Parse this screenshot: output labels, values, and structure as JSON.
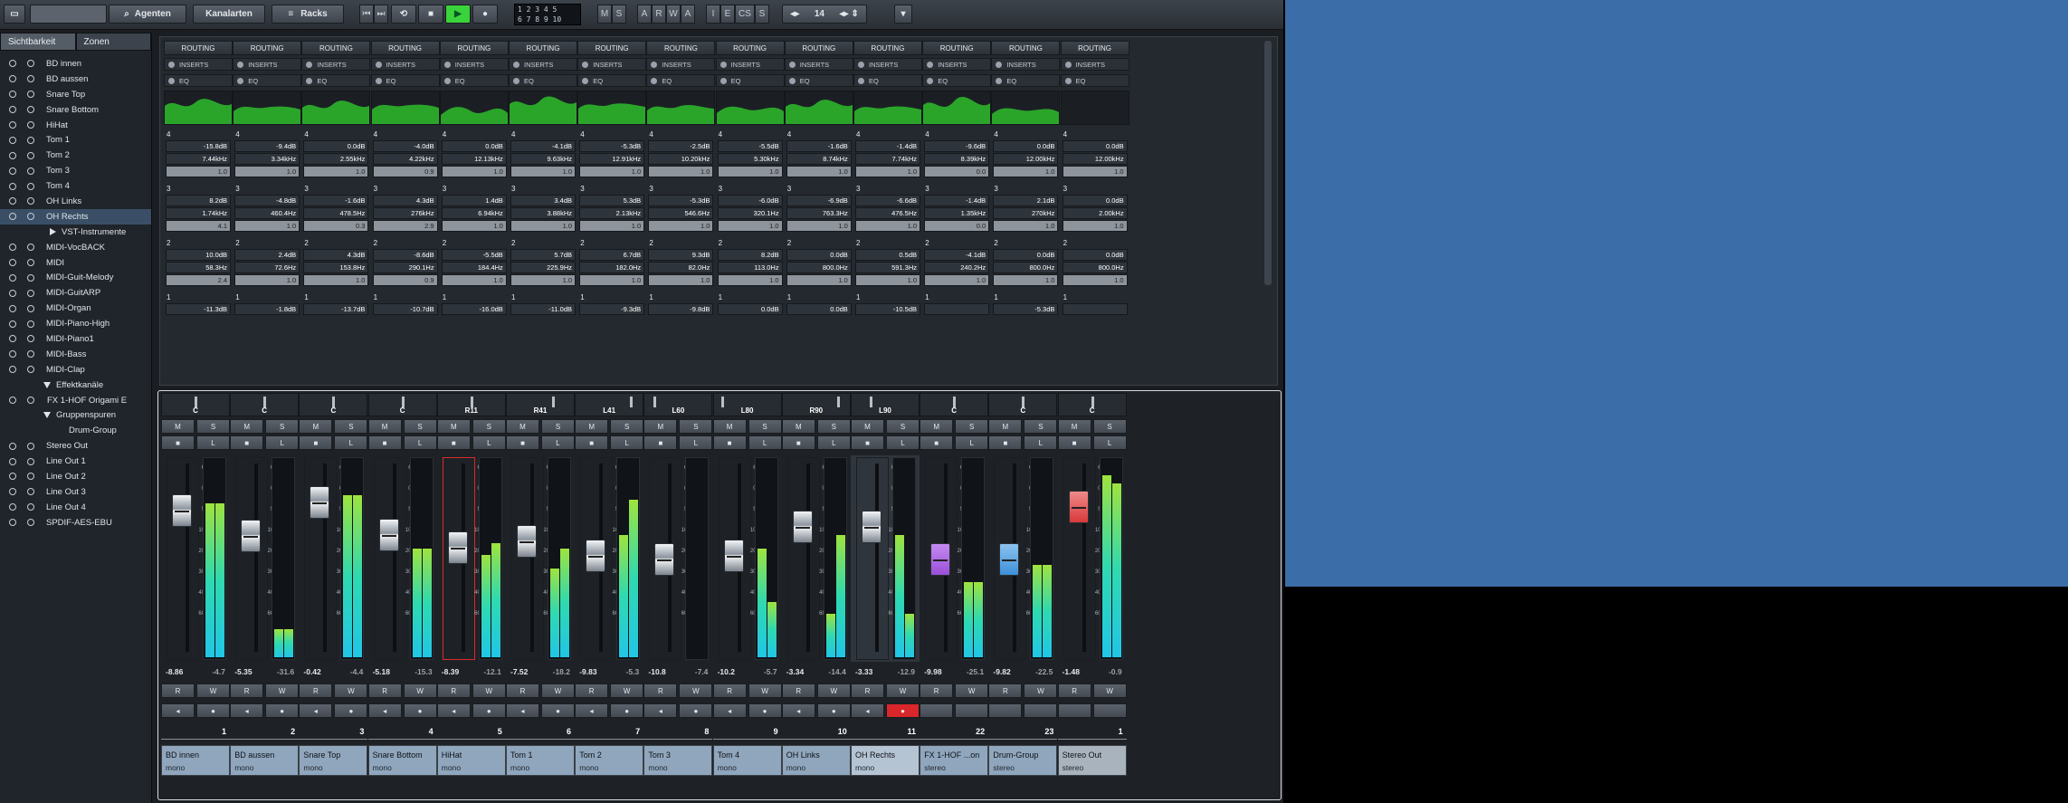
{
  "toolbar": {
    "agents": "Agenten",
    "channels": "Kanalarten",
    "racks": "Racks",
    "counter_top": "1 2 3 4 5",
    "counter_bottom": "6 7 8 9 10",
    "btn_m": "M",
    "btn_s": "S",
    "btn_a": "A",
    "btn_r": "R",
    "btn_w": "W",
    "btn_a2": "A",
    "btn_i": "I",
    "btn_e": "E",
    "btn_cs": "CS",
    "btn_s2": "S",
    "page_num": "14"
  },
  "sidebar": {
    "tabs": [
      "Sichtbarkeit",
      "Zonen"
    ],
    "items": [
      "BD innen",
      "BD aussen",
      "Snare Top",
      "Snare Bottom",
      "HiHat",
      "Tom 1",
      "Tom 2",
      "Tom 3",
      "Tom 4",
      "OH Links",
      "OH Rechts",
      "VST-Instrumente",
      "MIDI-VocBACK",
      "MIDI",
      "MIDI-Guit-Melody",
      "MIDI-GuitARP",
      "MIDI-Organ",
      "MIDI-Piano-High",
      "MIDI-Piano1",
      "MIDI-Bass",
      "MIDI-Clap",
      "Effektkanäle",
      "FX 1-HOF Origami E",
      "Gruppenspuren",
      "Drum-Group",
      "Stereo Out",
      "Line Out 1",
      "Line Out 2",
      "Line Out 3",
      "Line Out 4",
      "SPDIF-AES-EBU"
    ]
  },
  "rack": {
    "routing": "ROUTING",
    "inserts": "INSERTS",
    "eq": "EQ"
  },
  "channels": [
    {
      "name": "BD innen",
      "type": "mono",
      "num": "1",
      "pan": "C",
      "fader": "-8.86",
      "peak": "-4.7",
      "b4": [
        "4",
        "-15.8dB",
        "7.44kHz",
        "1.0"
      ],
      "b3": [
        "3",
        "8.2dB",
        "1.74kHz",
        "4.1"
      ],
      "b2": [
        "2",
        "10.0dB",
        "58.3Hz",
        "2.4"
      ],
      "b1": [
        "1",
        "-11.3dB"
      ],
      "fpos": 0.22,
      "m1": 0.78,
      "m2": 0.78
    },
    {
      "name": "BD aussen",
      "type": "mono",
      "num": "2",
      "pan": "C",
      "fader": "-5.35",
      "peak": "-31.6",
      "b4": [
        "4",
        "-9.4dB",
        "3.34kHz",
        "1.0"
      ],
      "b3": [
        "3",
        "-4.8dB",
        "460.4Hz",
        "1.0"
      ],
      "b2": [
        "2",
        "2.4dB",
        "72.6Hz",
        "1.0"
      ],
      "b1": [
        "1",
        "-1.8dB"
      ],
      "fpos": 0.38,
      "m1": 0.14,
      "m2": 0.14
    },
    {
      "name": "Snare Top",
      "type": "mono",
      "num": "3",
      "pan": "C",
      "fader": "-0.42",
      "peak": "-4.4",
      "b4": [
        "4",
        "0.0dB",
        "2.55kHz",
        "1.0"
      ],
      "b3": [
        "3",
        "-1.6dB",
        "478.5Hz",
        "0.3"
      ],
      "b2": [
        "2",
        "4.3dB",
        "153.8Hz",
        "1.0"
      ],
      "b1": [
        "1",
        "-13.7dB"
      ],
      "fpos": 0.17,
      "m1": 0.82,
      "m2": 0.82
    },
    {
      "name": "Snare Bottom",
      "type": "mono",
      "num": "4",
      "pan": "C",
      "fader": "-5.18",
      "peak": "-15.3",
      "b4": [
        "4",
        "-4.0dB",
        "4.22kHz",
        "0.9"
      ],
      "b3": [
        "3",
        "4.3dB",
        "276kHz",
        "2.9"
      ],
      "b2": [
        "2",
        "-8.6dB",
        "290.1Hz",
        "0.9"
      ],
      "b1": [
        "1",
        "-10.7dB"
      ],
      "fpos": 0.37,
      "m1": 0.55,
      "m2": 0.55
    },
    {
      "name": "HiHat",
      "type": "mono",
      "num": "5",
      "pan": "R11",
      "fader": "-8.39",
      "peak": "-12.1",
      "b4": [
        "4",
        "0.0dB",
        "12.13kHz",
        "1.0"
      ],
      "b3": [
        "3",
        "1.4dB",
        "6.94kHz",
        "1.0"
      ],
      "b2": [
        "2",
        "-5.5dB",
        "184.4Hz",
        "1.0"
      ],
      "b1": [
        "1",
        "-16.0dB"
      ],
      "fpos": 0.45,
      "m1": 0.52,
      "m2": 0.58
    },
    {
      "name": "Tom 1",
      "type": "mono",
      "num": "6",
      "pan": "R41",
      "fader": "-7.52",
      "peak": "-18.2",
      "b4": [
        "4",
        "-4.1dB",
        "9.63kHz",
        "1.0"
      ],
      "b3": [
        "3",
        "3.4dB",
        "3.88kHz",
        "1.0"
      ],
      "b2": [
        "2",
        "5.7dB",
        "225.9Hz",
        "1.0"
      ],
      "b1": [
        "1",
        "-11.0dB"
      ],
      "fpos": 0.41,
      "m1": 0.45,
      "m2": 0.55
    },
    {
      "name": "Tom 2",
      "type": "mono",
      "num": "7",
      "pan": "L41",
      "fader": "-9.83",
      "peak": "-5.3",
      "b4": [
        "4",
        "-5.3dB",
        "12.91kHz",
        "1.0"
      ],
      "b3": [
        "3",
        "5.3dB",
        "2.13kHz",
        "1.0"
      ],
      "b2": [
        "2",
        "6.7dB",
        "182.0Hz",
        "1.0"
      ],
      "b1": [
        "1",
        "-9.3dB"
      ],
      "fpos": 0.5,
      "m1": 0.62,
      "m2": 0.8
    },
    {
      "name": "Tom 3",
      "type": "mono",
      "num": "8",
      "pan": "L60",
      "fader": "-10.8",
      "peak": "-7.4",
      "b4": [
        "4",
        "-2.5dB",
        "10.20kHz",
        "1.0"
      ],
      "b3": [
        "3",
        "-5.3dB",
        "546.6Hz",
        "1.0"
      ],
      "b2": [
        "2",
        "9.3dB",
        "82.0Hz",
        "1.0"
      ],
      "b1": [
        "1",
        "-9.8dB"
      ],
      "fpos": 0.52,
      "m1": 0.0,
      "m2": 0.0
    },
    {
      "name": "Tom 4",
      "type": "mono",
      "num": "9",
      "pan": "L80",
      "fader": "-10.2",
      "peak": "-5.7",
      "b4": [
        "4",
        "-5.5dB",
        "5.30kHz",
        "1.0"
      ],
      "b3": [
        "3",
        "-6.0dB",
        "320.1Hz",
        "1.0"
      ],
      "b2": [
        "2",
        "8.2dB",
        "113.0Hz",
        "1.0"
      ],
      "b1": [
        "1",
        "0.0dB"
      ],
      "fpos": 0.5,
      "m1": 0.55,
      "m2": 0.28
    },
    {
      "name": "OH Links",
      "type": "mono",
      "num": "10",
      "pan": "R90",
      "fader": "-3.34",
      "peak": "-14.4",
      "b4": [
        "4",
        "-1.6dB",
        "8.74kHz",
        "1.0"
      ],
      "b3": [
        "3",
        "-6.9dB",
        "763.3Hz",
        "1.0"
      ],
      "b2": [
        "2",
        "0.0dB",
        "800.0Hz",
        "1.0"
      ],
      "b1": [
        "1",
        "0.0dB"
      ],
      "fpos": 0.32,
      "m1": 0.22,
      "m2": 0.62
    },
    {
      "name": "OH Rechts",
      "type": "mono",
      "num": "11",
      "pan": "L90",
      "fader": "-3.33",
      "peak": "-12.9",
      "b4": [
        "4",
        "-1.4dB",
        "7.74kHz",
        "1.0"
      ],
      "b3": [
        "3",
        "-6.6dB",
        "476.5Hz",
        "1.0"
      ],
      "b2": [
        "2",
        "0.5dB",
        "591.3Hz",
        "1.0"
      ],
      "b1": [
        "1",
        "-10.5dB"
      ],
      "fpos": 0.32,
      "m1": 0.62,
      "m2": 0.22
    },
    {
      "name": "FX 1-HOF ...on",
      "type": "stereo",
      "num": "22",
      "pan": "C",
      "fader": "-9.98",
      "peak": "-25.1",
      "b4": [
        "4",
        "-9.6dB",
        "8.39kHz",
        "0.0"
      ],
      "b3": [
        "3",
        "-1.4dB",
        "1.35kHz",
        "0.0"
      ],
      "b2": [
        "2",
        "-4.1dB",
        "240.2Hz",
        "1.0"
      ],
      "b1": [
        "1",
        ""
      ],
      "fpos": 0.52,
      "m1": 0.38,
      "m2": 0.38
    },
    {
      "name": "Drum-Group",
      "type": "stereo",
      "num": "23",
      "pan": "C",
      "fader": "-9.82",
      "peak": "-22.5",
      "b4": [
        "4",
        "0.0dB",
        "12.00kHz",
        "1.0"
      ],
      "b3": [
        "3",
        "2.1dB",
        "270kHz",
        "1.0"
      ],
      "b2": [
        "2",
        "0.0dB",
        "800.0Hz",
        "1.0"
      ],
      "b1": [
        "1",
        "-5.3dB"
      ],
      "fpos": 0.52,
      "m1": 0.47,
      "m2": 0.47
    },
    {
      "name": "Stereo Out",
      "type": "stereo",
      "num": "1",
      "pan": "C",
      "fader": "-1.48",
      "peak": "-0.9",
      "b4": [
        "4",
        "0.0dB",
        "12.00kHz",
        "1.0"
      ],
      "b3": [
        "3",
        "0.0dB",
        "2.00kHz",
        "1.0"
      ],
      "b2": [
        "2",
        "0.0dB",
        "800.0Hz",
        "1.0"
      ],
      "b1": [
        "1",
        ""
      ],
      "fpos": 0.2,
      "m1": 0.92,
      "m2": 0.88
    }
  ],
  "colors": {
    "accent_sel": "#b5c4d3",
    "name_strip": "#8fa6bd",
    "record": "#d9262a",
    "purple_cap": "#9a4fd8",
    "blue_cap": "#3d8fd8",
    "red_cap": "#d8393a"
  }
}
